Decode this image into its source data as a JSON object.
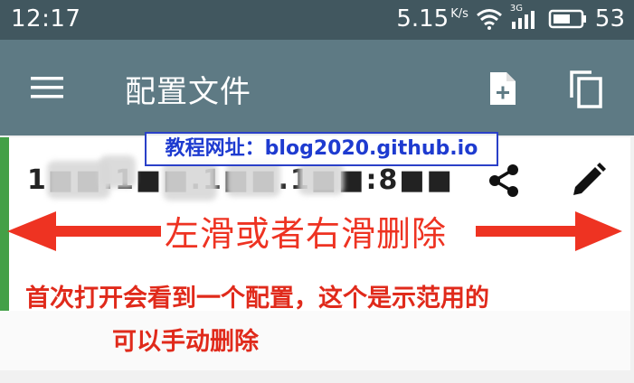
{
  "status_bar": {
    "time": "12:17",
    "speed": "5.15",
    "speed_unit": "K/s",
    "network": "3G",
    "battery": "53",
    "icons": [
      "wifi-icon",
      "signal-icon",
      "battery-icon"
    ]
  },
  "toolbar": {
    "title": "配置文件",
    "icons": [
      "menu-icon",
      "new-file-icon",
      "copy-icon"
    ]
  },
  "profile_item": {
    "address": "1■■.1■■.1■■.1■■:8■■",
    "icons": [
      "share-icon",
      "edit-icon"
    ],
    "accent": "#43a047"
  },
  "overlay": {
    "watermark": "教程网址：blog2020.github.io",
    "swipe_hint": "左滑或者右滑删除",
    "note_line1": "首次打开会看到一个配置，这个是示范用的",
    "note_line2": "可以手动删除",
    "annotation_color": "#e02a1b"
  },
  "colors": {
    "status_bar": "#41575f",
    "toolbar": "#5e7a84"
  }
}
